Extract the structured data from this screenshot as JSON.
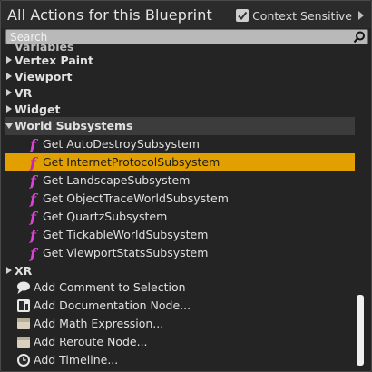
{
  "header": {
    "title": "All Actions for this Blueprint",
    "context_sensitive_label": "Context Sensitive",
    "context_sensitive_checked": true
  },
  "search": {
    "placeholder": "Search",
    "value": ""
  },
  "list": {
    "partial_category": "Variables",
    "categories": [
      {
        "label": "Vertex Paint",
        "expanded": false
      },
      {
        "label": "Viewport",
        "expanded": false
      },
      {
        "label": "VR",
        "expanded": false
      },
      {
        "label": "Widget",
        "expanded": false
      },
      {
        "label": "World Subsystems",
        "expanded": true
      }
    ],
    "functions": [
      {
        "label": "Get AutoDestroySubsystem",
        "selected": false
      },
      {
        "label": "Get InternetProtocolSubsystem",
        "selected": true
      },
      {
        "label": "Get LandscapeSubsystem",
        "selected": false
      },
      {
        "label": "Get ObjectTraceWorldSubsystem",
        "selected": false
      },
      {
        "label": "Get QuartzSubsystem",
        "selected": false
      },
      {
        "label": "Get TickableWorldSubsystem",
        "selected": false
      },
      {
        "label": "Get ViewportStatsSubsystem",
        "selected": false
      }
    ],
    "category_after": {
      "label": "XR",
      "expanded": false
    },
    "actions": [
      {
        "label": "Add Comment to Selection",
        "icon": "comment-icon"
      },
      {
        "label": "Add Documentation Node...",
        "icon": "documentation-icon"
      },
      {
        "label": "Add Math Expression...",
        "icon": "node-icon"
      },
      {
        "label": "Add Reroute Node...",
        "icon": "node-icon"
      },
      {
        "label": "Add Timeline...",
        "icon": "clock-icon"
      }
    ]
  },
  "colors": {
    "selection": "#e2a000",
    "function_icon": "#e040d8",
    "background": "#242424"
  }
}
